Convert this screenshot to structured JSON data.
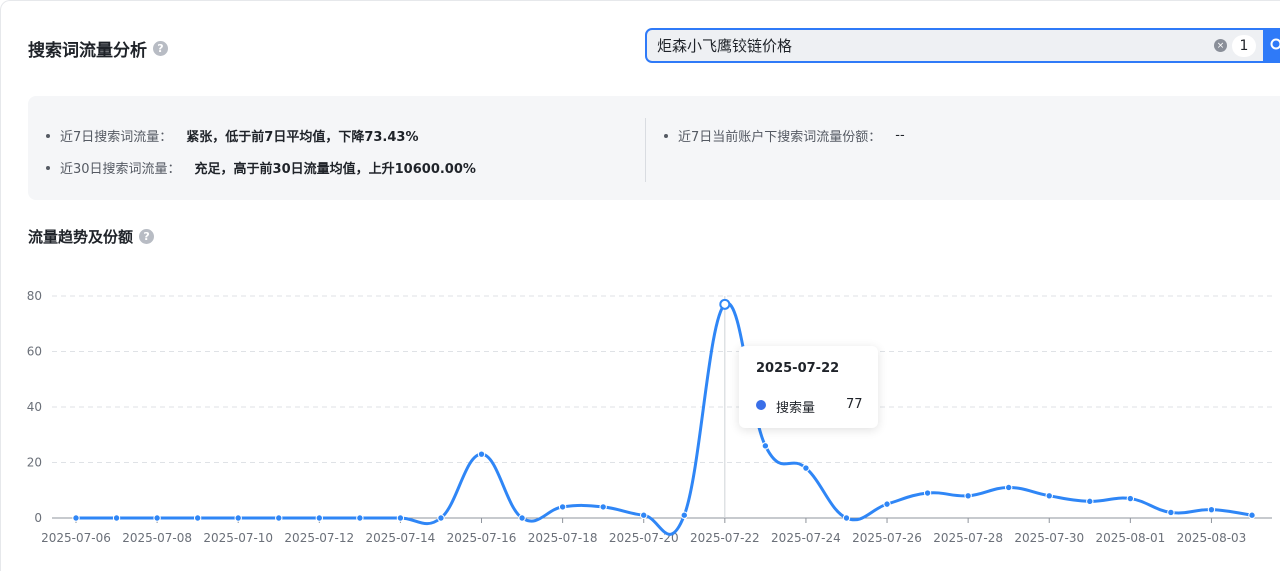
{
  "header": {
    "title": "搜索词流量分析",
    "help_icon": "?"
  },
  "search": {
    "value": "炬森小飞鹰铰链价格",
    "clear_icon": "×",
    "count": "1"
  },
  "summary": {
    "line1_label": "近7日搜索词流量：",
    "line1_value": "紧张，低于前7日平均值，下降73.43%",
    "line2_label": "近30日搜索词流量：",
    "line2_value": "充足，高于前30日流量均值，上升10600.00%",
    "line3_label": "近7日当前账户下搜索词流量份额：",
    "line3_value": "--"
  },
  "section": {
    "title": "流量趋势及份额",
    "help_icon": "?"
  },
  "tooltip": {
    "date": "2025-07-22",
    "series_name": "搜索量",
    "value": "77"
  },
  "chart_data": {
    "type": "line",
    "x": [
      "2025-07-06",
      "2025-07-07",
      "2025-07-08",
      "2025-07-09",
      "2025-07-10",
      "2025-07-11",
      "2025-07-12",
      "2025-07-13",
      "2025-07-14",
      "2025-07-15",
      "2025-07-16",
      "2025-07-17",
      "2025-07-18",
      "2025-07-19",
      "2025-07-20",
      "2025-07-21",
      "2025-07-22",
      "2025-07-23",
      "2025-07-24",
      "2025-07-25",
      "2025-07-26",
      "2025-07-27",
      "2025-07-28",
      "2025-07-29",
      "2025-07-30",
      "2025-07-31",
      "2025-08-01",
      "2025-08-02",
      "2025-08-03",
      "2025-08-04"
    ],
    "x_tick_labels": [
      "2025-07-06",
      "2025-07-08",
      "2025-07-10",
      "2025-07-12",
      "2025-07-14",
      "2025-07-16",
      "2025-07-18",
      "2025-07-20",
      "2025-07-22",
      "2025-07-24",
      "2025-07-26",
      "2025-07-28",
      "2025-07-30",
      "2025-08-01",
      "2025-08-03"
    ],
    "series": [
      {
        "name": "搜索量",
        "color": "#2f86f6",
        "values": [
          0,
          0,
          0,
          0,
          0,
          0,
          0,
          0,
          0,
          0,
          23,
          0,
          4,
          4,
          1,
          1,
          77,
          26,
          18,
          0,
          5,
          9,
          8,
          11,
          8,
          6,
          7,
          2,
          3,
          1
        ]
      }
    ],
    "y_ticks": [
      0,
      20,
      40,
      60,
      80
    ],
    "ylim": [
      0,
      80
    ],
    "grid": true,
    "highlight_index": 16
  }
}
